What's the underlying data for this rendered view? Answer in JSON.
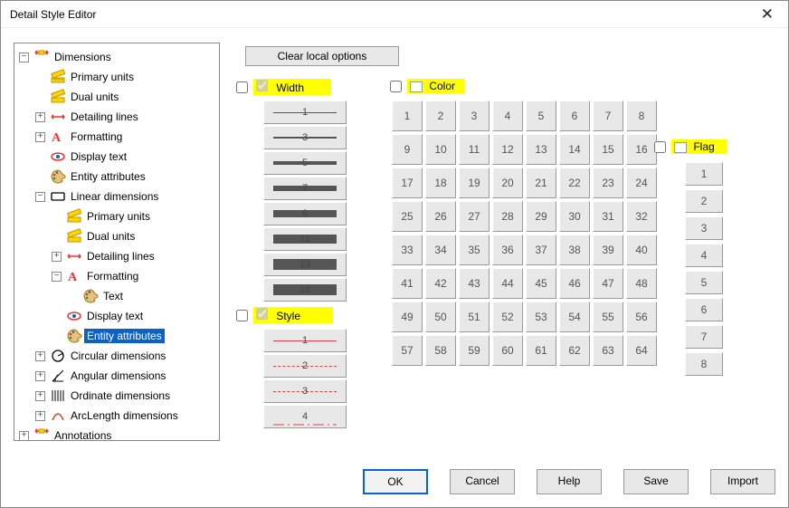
{
  "title": "Detail Style Editor",
  "tree": {
    "dimensions": "Dimensions",
    "primary_units": "Primary units",
    "dual_units": "Dual units",
    "detailing_lines": "Detailing lines",
    "formatting": "Formatting",
    "display_text": "Display text",
    "entity_attributes": "Entity attributes",
    "linear_dimensions": "Linear dimensions",
    "text": "Text",
    "circular_dimensions": "Circular dimensions",
    "angular_dimensions": "Angular dimensions",
    "ordinate_dimensions": "Ordinate dimensions",
    "arclength_dimensions": "ArcLength dimensions",
    "annotations": "Annotations"
  },
  "actions": {
    "clear_local": "Clear local options",
    "ok": "OK",
    "cancel": "Cancel",
    "help": "Help",
    "save": "Save",
    "import": "Import"
  },
  "groups": {
    "width": "Width",
    "color": "Color",
    "style": "Style",
    "flag": "Flag"
  },
  "width_options": [
    "1",
    "3",
    "5",
    "7",
    "9",
    "11",
    "13",
    "15"
  ],
  "style_options": [
    "1",
    "2",
    "3",
    "4"
  ],
  "color_count": 64,
  "flag_count": 8
}
